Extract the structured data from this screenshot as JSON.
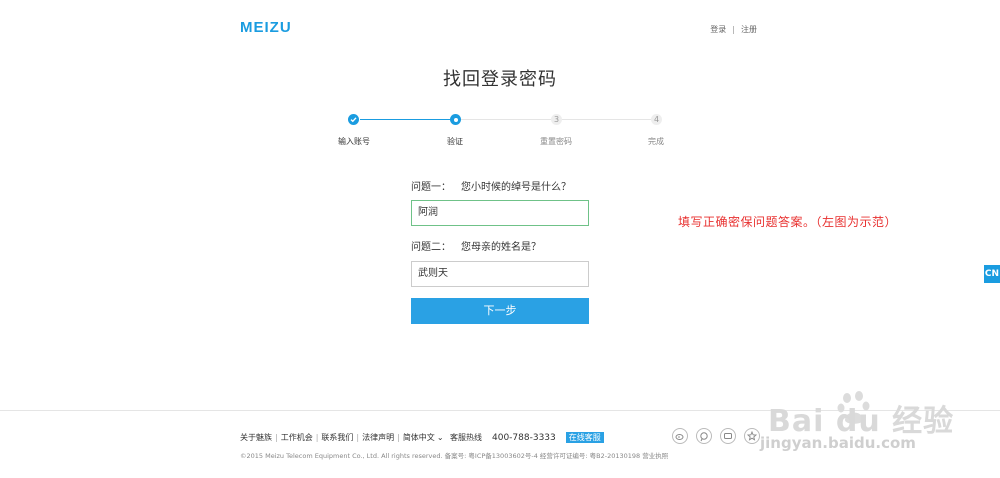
{
  "header": {
    "logo": "MEIZU",
    "login": "登录",
    "divider": "|",
    "register": "注册"
  },
  "title": "找回登录密码",
  "steps": [
    {
      "number": "",
      "label": "输入账号",
      "state": "done"
    },
    {
      "number": "",
      "label": "验证",
      "state": "current"
    },
    {
      "number": "3",
      "label": "重置密码",
      "state": "todo"
    },
    {
      "number": "4",
      "label": "完成",
      "state": "todo"
    }
  ],
  "form": {
    "q1_label": "问题一：",
    "q1_text": "您小时候的绰号是什么？",
    "q1_value": "阿润",
    "q2_label": "问题二：",
    "q2_text": "您母亲的姓名是？",
    "q2_value": "武则天",
    "submit": "下一步"
  },
  "annotation": "填写正确密保问题答案。（左图为示范）",
  "side_tab": "CN",
  "footer": {
    "links": [
      "关于魅族",
      "工作机会",
      "联系我们",
      "法律声明",
      "简体中文"
    ],
    "lang_suffix": "⌄",
    "hotline_label": "客服热线",
    "hotline_number": "400-788-3333",
    "online_service": "在线客服",
    "copyright": "©2015 Meizu Telecom Equipment Co., Ltd. All rights reserved.  备案号: 粤ICP备13003602号-4  经营许可证编号: 粤B2-20130198  营业执照"
  },
  "social_icons": [
    "weibo-icon",
    "chat-icon",
    "message-icon",
    "star-icon"
  ],
  "watermark": {
    "text": "Bai  du 经验",
    "url": "jingyan.baidu.com"
  },
  "colors": {
    "accent": "#1a9ce0",
    "button": "#2aa1e4",
    "annotation": "#e8302f",
    "focus_border": "#6fc288"
  }
}
